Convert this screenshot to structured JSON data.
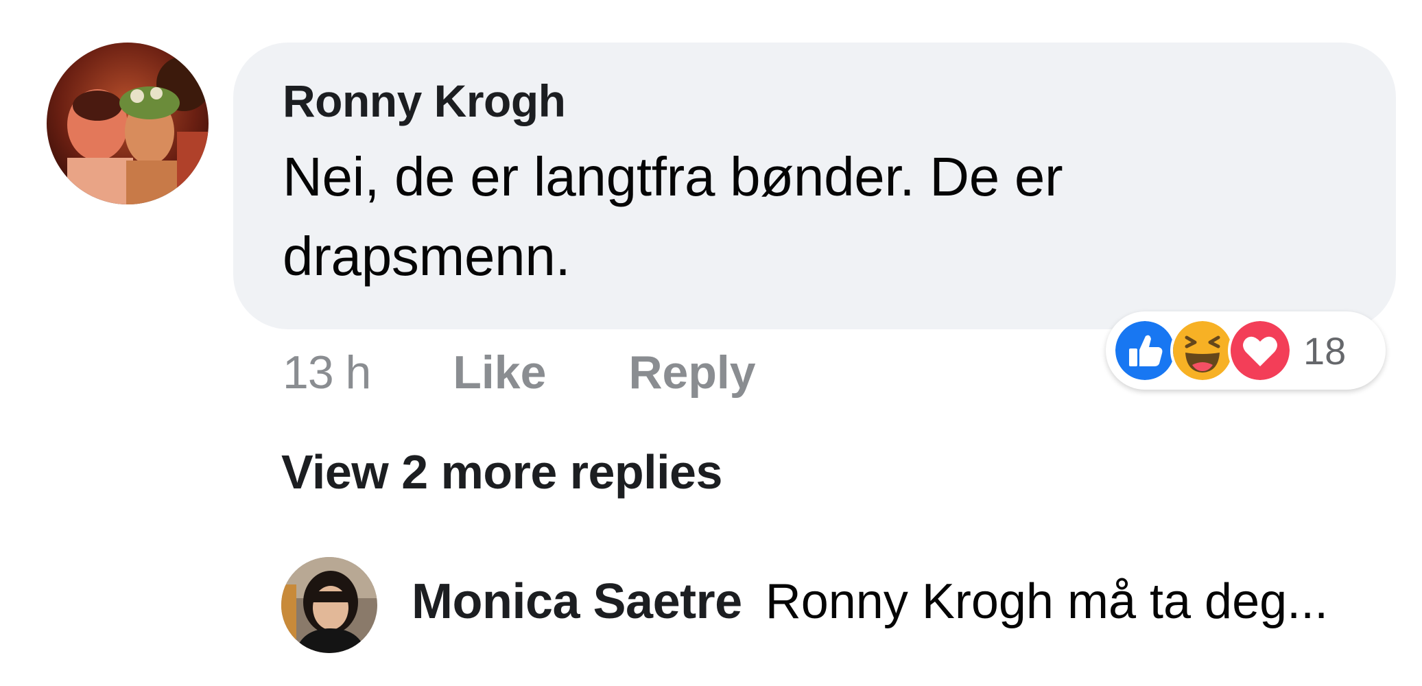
{
  "comment": {
    "author": "Ronny Krogh",
    "text": "Nei, de er langtfra bønder. De er drapsmenn.",
    "timestamp": "13 h",
    "like_label": "Like",
    "reply_label": "Reply",
    "reactions": {
      "types": [
        "like-icon",
        "haha-icon",
        "love-icon"
      ],
      "count": "18"
    }
  },
  "view_more_label": "View 2 more replies",
  "reply_preview": {
    "author": "Monica Saetre",
    "snippet": "Ronny Krogh må ta deg..."
  },
  "colors": {
    "bubble_bg": "#f0f2f5",
    "meta_gray": "#8a8d91",
    "like_blue": "#1877f2",
    "love_red": "#f33e58",
    "haha_yellow": "#f7b125"
  }
}
